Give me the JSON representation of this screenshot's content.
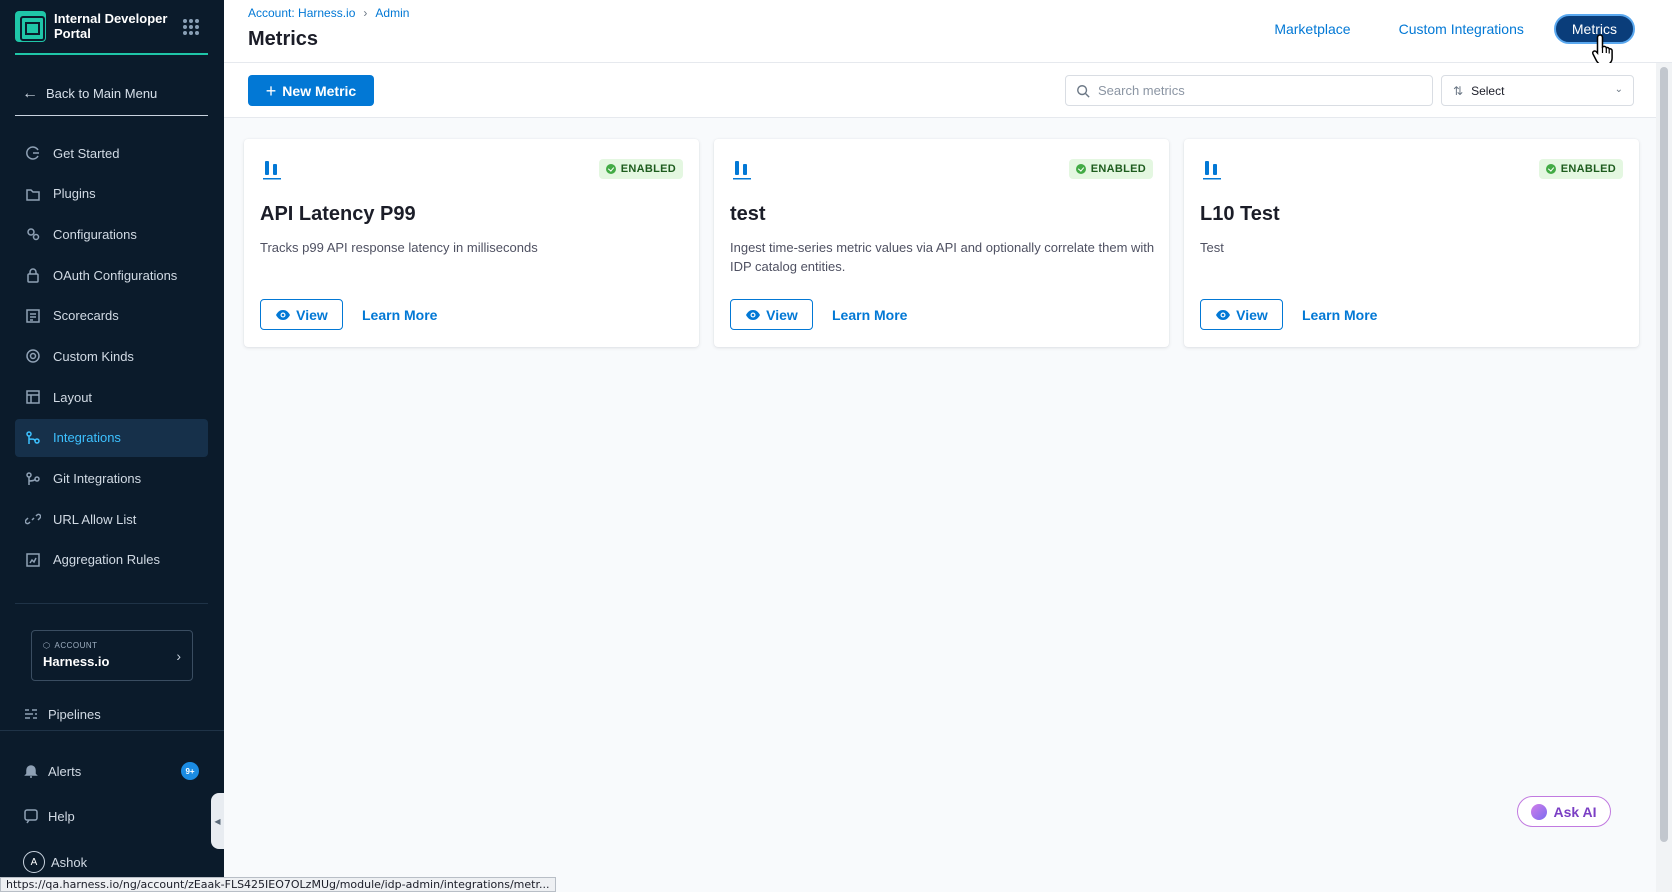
{
  "sidebar": {
    "brand": "Internal Developer Portal",
    "back_label": "Back to Main Menu",
    "items": [
      {
        "label": "Get Started",
        "icon": "get-started-icon"
      },
      {
        "label": "Plugins",
        "icon": "plugins-icon"
      },
      {
        "label": "Configurations",
        "icon": "configurations-icon"
      },
      {
        "label": "OAuth Configurations",
        "icon": "lock-icon"
      },
      {
        "label": "Scorecards",
        "icon": "scorecards-icon"
      },
      {
        "label": "Custom Kinds",
        "icon": "gear-icon"
      },
      {
        "label": "Layout",
        "icon": "layout-icon"
      },
      {
        "label": "Integrations",
        "icon": "integrations-icon",
        "active": true
      },
      {
        "label": "Git Integrations",
        "icon": "git-icon"
      },
      {
        "label": "URL Allow List",
        "icon": "link-icon"
      },
      {
        "label": "Aggregation Rules",
        "icon": "aggregation-icon"
      }
    ],
    "account": {
      "label": "ACCOUNT",
      "name": "Harness.io"
    },
    "pipelines_label": "Pipelines",
    "alerts_label": "Alerts",
    "alerts_badge": "9+",
    "help_label": "Help",
    "user_initial": "A",
    "user_name": "Ashok"
  },
  "header": {
    "breadcrumb": [
      "Account: Harness.io",
      "Admin"
    ],
    "title": "Metrics",
    "tabs": [
      {
        "label": "Marketplace",
        "active": false
      },
      {
        "label": "Custom Integrations",
        "active": false
      },
      {
        "label": "Metrics",
        "active": true
      }
    ]
  },
  "toolbar": {
    "new_label": "New Metric",
    "search_placeholder": "Search metrics",
    "select_label": "Select"
  },
  "cards": [
    {
      "title": "API Latency P99",
      "status": "ENABLED",
      "description": "Tracks p99 API response latency in milliseconds",
      "view_label": "View",
      "learn_label": "Learn More"
    },
    {
      "title": "test",
      "status": "ENABLED",
      "description": "Ingest time-series metric values via API and optionally correlate them with IDP catalog entities.",
      "view_label": "View",
      "learn_label": "Learn More"
    },
    {
      "title": "L10 Test",
      "status": "ENABLED",
      "description": "Test",
      "view_label": "View",
      "learn_label": "Learn More"
    }
  ],
  "ask_ai_label": "Ask AI",
  "status_url": "https://qa.harness.io/ng/account/zEaak-FLS425IEO7OLzMUg/module/idp-admin/integrations/metr...",
  "colors": {
    "primary": "#0278d5",
    "sidebar_bg": "#0b1b2b",
    "brand": "#1fc6a8",
    "enabled_bg": "#e4f7e1"
  }
}
